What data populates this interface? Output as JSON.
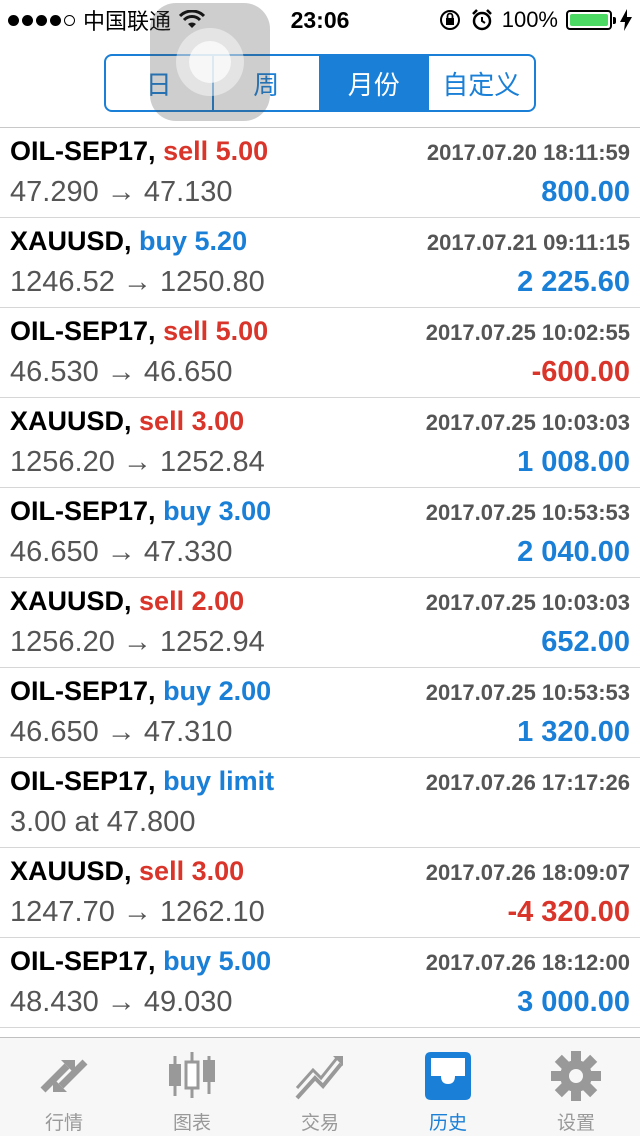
{
  "status_bar": {
    "carrier": "中国联通",
    "time": "23:06",
    "battery": "100%"
  },
  "segments": [
    {
      "label": "日",
      "active": false
    },
    {
      "label": "周",
      "active": false
    },
    {
      "label": "月份",
      "active": true
    },
    {
      "label": "自定义",
      "active": false
    }
  ],
  "deals": [
    {
      "symbol": "OIL-SEP17,",
      "side": "sell",
      "detail": "sell 5.00",
      "time": "2017.07.20 18:11:59",
      "prices": "47.290 → 47.130",
      "profit": "800.00",
      "profit_sign": "pos"
    },
    {
      "symbol": "XAUUSD,",
      "side": "buy",
      "detail": "buy 5.20",
      "time": "2017.07.21 09:11:15",
      "prices": "1246.52 → 1250.80",
      "profit": "2 225.60",
      "profit_sign": "pos"
    },
    {
      "symbol": "OIL-SEP17,",
      "side": "sell",
      "detail": "sell 5.00",
      "time": "2017.07.25 10:02:55",
      "prices": "46.530 → 46.650",
      "profit": "-600.00",
      "profit_sign": "neg"
    },
    {
      "symbol": "XAUUSD,",
      "side": "sell",
      "detail": "sell 3.00",
      "time": "2017.07.25 10:03:03",
      "prices": "1256.20 → 1252.84",
      "profit": "1 008.00",
      "profit_sign": "pos"
    },
    {
      "symbol": "OIL-SEP17,",
      "side": "buy",
      "detail": "buy 3.00",
      "time": "2017.07.25 10:53:53",
      "prices": "46.650 → 47.330",
      "profit": "2 040.00",
      "profit_sign": "pos"
    },
    {
      "symbol": "XAUUSD,",
      "side": "sell",
      "detail": "sell 2.00",
      "time": "2017.07.25 10:03:03",
      "prices": "1256.20 → 1252.94",
      "profit": "652.00",
      "profit_sign": "pos"
    },
    {
      "symbol": "OIL-SEP17,",
      "side": "buy",
      "detail": "buy 2.00",
      "time": "2017.07.25 10:53:53",
      "prices": "46.650 → 47.310",
      "profit": "1 320.00",
      "profit_sign": "pos"
    },
    {
      "symbol": "OIL-SEP17,",
      "side": "buy",
      "detail": "buy limit",
      "time": "2017.07.26 17:17:26",
      "prices": "3.00 at 47.800",
      "profit": "",
      "profit_sign": "pos"
    },
    {
      "symbol": "XAUUSD,",
      "side": "sell",
      "detail": "sell 3.00",
      "time": "2017.07.26 18:09:07",
      "prices": "1247.70 → 1262.10",
      "profit": "-4 320.00",
      "profit_sign": "neg"
    },
    {
      "symbol": "OIL-SEP17,",
      "side": "buy",
      "detail": "buy 5.00",
      "time": "2017.07.26 18:12:00",
      "prices": "48.430 → 49.030",
      "profit": "3 000.00",
      "profit_sign": "pos"
    }
  ],
  "tabs": [
    {
      "label": "行情",
      "icon": "quotes-arrows-icon",
      "active": false
    },
    {
      "label": "图表",
      "icon": "candlestick-chart-icon",
      "active": false
    },
    {
      "label": "交易",
      "icon": "trade-trend-icon",
      "active": false
    },
    {
      "label": "历史",
      "icon": "history-inbox-icon",
      "active": true
    },
    {
      "label": "设置",
      "icon": "settings-gear-icon",
      "active": false
    }
  ],
  "colors": {
    "accent": "#1a7fd6",
    "sell": "#d9352a",
    "battery": "#4cd964"
  }
}
